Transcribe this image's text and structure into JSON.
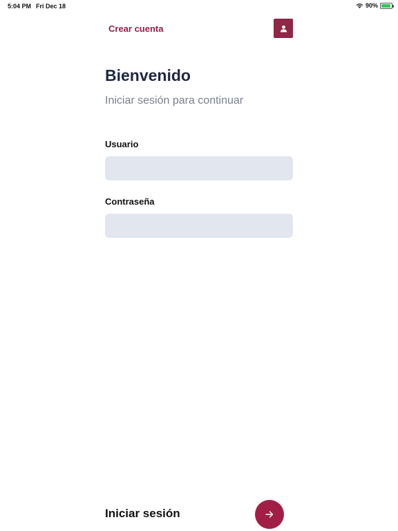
{
  "status_bar": {
    "time": "5:04 PM",
    "date": "Fri Dec 18",
    "battery_percent": "90%",
    "battery_level": 0.9
  },
  "header": {
    "create_account_label": "Crear cuenta",
    "profile_icon": "person-icon"
  },
  "login": {
    "title": "Bienvenido",
    "subtitle": "Iniciar sesión para continuar",
    "username_label": "Usuario",
    "username_value": "",
    "password_label": "Contraseña",
    "password_value": ""
  },
  "footer": {
    "submit_label": "Iniciar sesión",
    "submit_icon": "arrow-right-icon"
  },
  "colors": {
    "accent": "#9b1c45",
    "field_bg": "#e2e6ee",
    "title": "#1e2a40"
  }
}
